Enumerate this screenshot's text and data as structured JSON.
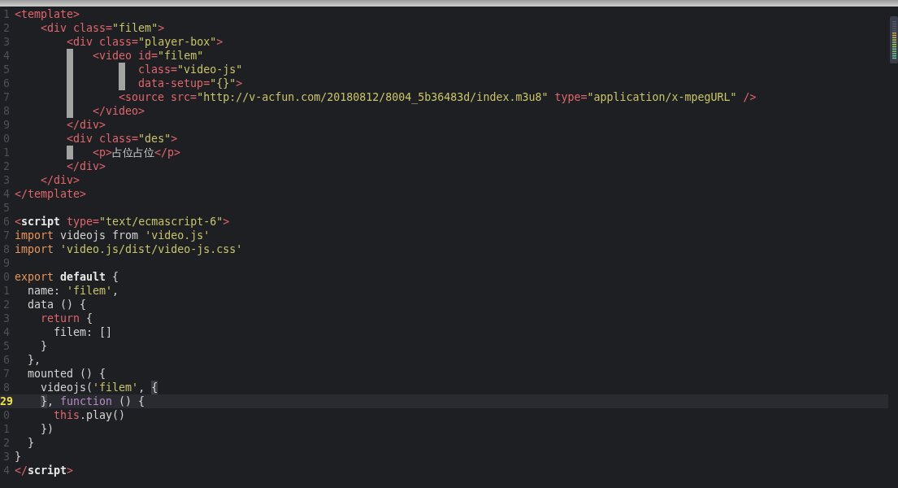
{
  "editor": {
    "lines": [
      {
        "number": "1",
        "current": false,
        "tokens": [
          {
            "kind": "tag",
            "text": "<template>"
          }
        ]
      },
      {
        "number": "2",
        "current": false,
        "tokens": [
          {
            "kind": "tag",
            "text": "    <div class="
          },
          {
            "kind": "string",
            "text": "\"filem\""
          },
          {
            "kind": "tag",
            "text": ">"
          }
        ]
      },
      {
        "number": "3",
        "current": false,
        "tokens": [
          {
            "kind": "tag",
            "text": "        <div class="
          },
          {
            "kind": "string",
            "text": "\"player-box\""
          },
          {
            "kind": "tag",
            "text": ">"
          }
        ]
      },
      {
        "number": "4",
        "current": false,
        "tokens": [
          {
            "kind": "indent"
          },
          {
            "kind": "indent"
          },
          {
            "kind": "guide-tab"
          },
          {
            "kind": "tag",
            "text": "<video id="
          },
          {
            "kind": "string",
            "text": "\"filem\""
          }
        ]
      },
      {
        "number": "5",
        "current": false,
        "tokens": [
          {
            "kind": "indent"
          },
          {
            "kind": "indent"
          },
          {
            "kind": "guide-tab"
          },
          {
            "kind": "indent"
          },
          {
            "kind": "guide"
          },
          {
            "kind": "tag",
            "text": "  class="
          },
          {
            "kind": "string",
            "text": "\"video-js\""
          }
        ]
      },
      {
        "number": "6",
        "current": false,
        "tokens": [
          {
            "kind": "indent"
          },
          {
            "kind": "indent"
          },
          {
            "kind": "guide-tab"
          },
          {
            "kind": "indent"
          },
          {
            "kind": "guide"
          },
          {
            "kind": "tag",
            "text": "  data-setup="
          },
          {
            "kind": "string",
            "text": "\"{}\""
          },
          {
            "kind": "tag",
            "text": ">"
          }
        ]
      },
      {
        "number": "7",
        "current": false,
        "tokens": [
          {
            "kind": "indent"
          },
          {
            "kind": "indent"
          },
          {
            "kind": "guide-tab"
          },
          {
            "kind": "indent"
          },
          {
            "kind": "tag",
            "text": "<source src="
          },
          {
            "kind": "string",
            "text": "\"http://v-acfun.com/20180812/8004_5b36483d/index.m3u8\""
          },
          {
            "kind": "tag",
            "text": " type="
          },
          {
            "kind": "string",
            "text": "\"application/x-mpegURL\""
          },
          {
            "kind": "tag",
            "text": " />"
          }
        ]
      },
      {
        "number": "8",
        "current": false,
        "tokens": [
          {
            "kind": "indent"
          },
          {
            "kind": "indent"
          },
          {
            "kind": "guide-tab"
          },
          {
            "kind": "tag",
            "text": "</video>"
          }
        ]
      },
      {
        "number": "9",
        "current": false,
        "tokens": [
          {
            "kind": "tag",
            "text": "        </div>"
          }
        ]
      },
      {
        "number": "0",
        "current": false,
        "tokens": [
          {
            "kind": "tag",
            "text": "        <div class="
          },
          {
            "kind": "string",
            "text": "\"des\""
          },
          {
            "kind": "tag",
            "text": ">"
          }
        ]
      },
      {
        "number": "1",
        "current": false,
        "tokens": [
          {
            "kind": "indent"
          },
          {
            "kind": "indent"
          },
          {
            "kind": "guide-tab"
          },
          {
            "kind": "tag",
            "text": "<p>"
          },
          {
            "kind": "plain",
            "text": "占位占位"
          },
          {
            "kind": "tag",
            "text": "</p>"
          }
        ]
      },
      {
        "number": "2",
        "current": false,
        "tokens": [
          {
            "kind": "tag",
            "text": "        </div>"
          }
        ]
      },
      {
        "number": "3",
        "current": false,
        "tokens": [
          {
            "kind": "tag",
            "text": "    </div>"
          }
        ]
      },
      {
        "number": "4",
        "current": false,
        "tokens": [
          {
            "kind": "tag",
            "text": "</template>"
          }
        ]
      },
      {
        "number": "5",
        "current": false
      },
      {
        "number": "6",
        "current": false,
        "tokens": [
          {
            "kind": "tag",
            "text": "<"
          },
          {
            "kind": "bold",
            "text": "script"
          },
          {
            "kind": "tag",
            "text": " type="
          },
          {
            "kind": "string",
            "text": "\"text/ecmascript-6\""
          },
          {
            "kind": "tag",
            "text": ">"
          }
        ]
      },
      {
        "number": "7",
        "current": false,
        "tokens": [
          {
            "kind": "keyword",
            "text": "import"
          },
          {
            "kind": "plain",
            "text": " videojs from "
          },
          {
            "kind": "string",
            "text": "'video.js'"
          }
        ]
      },
      {
        "number": "8",
        "current": false,
        "tokens": [
          {
            "kind": "keyword",
            "text": "import"
          },
          {
            "kind": "string",
            "text": " 'video.js/dist/video-js.css'"
          }
        ]
      },
      {
        "number": "9",
        "current": false
      },
      {
        "number": "0",
        "current": false,
        "tokens": [
          {
            "kind": "keyword",
            "text": "export"
          },
          {
            "kind": "bold",
            "text": " default"
          },
          {
            "kind": "plain",
            "text": " {"
          }
        ]
      },
      {
        "number": "1",
        "current": false,
        "tokens": [
          {
            "kind": "plain",
            "text": "  name: "
          },
          {
            "kind": "string",
            "text": "'filem'"
          },
          {
            "kind": "plain",
            "text": ","
          }
        ]
      },
      {
        "number": "2",
        "current": false,
        "tokens": [
          {
            "kind": "plain",
            "text": "  data () {"
          }
        ]
      },
      {
        "number": "3",
        "current": false,
        "tokens": [
          {
            "kind": "control",
            "text": "    return"
          },
          {
            "kind": "plain",
            "text": " {"
          }
        ]
      },
      {
        "number": "4",
        "current": false,
        "tokens": [
          {
            "kind": "plain",
            "text": "      filem: []"
          }
        ]
      },
      {
        "number": "5",
        "current": false,
        "tokens": [
          {
            "kind": "plain",
            "text": "    }"
          }
        ]
      },
      {
        "number": "6",
        "current": false,
        "tokens": [
          {
            "kind": "plain",
            "text": "  },"
          }
        ]
      },
      {
        "number": "7",
        "current": false,
        "tokens": [
          {
            "kind": "plain",
            "text": "  mounted () {"
          }
        ]
      },
      {
        "number": "8",
        "current": false,
        "tokens": [
          {
            "kind": "plain",
            "text": "    videojs("
          },
          {
            "kind": "string",
            "text": "'filem'"
          },
          {
            "kind": "plain",
            "text": ", "
          },
          {
            "kind": "match",
            "text": "{"
          }
        ]
      },
      {
        "number": "29",
        "current": true,
        "tokens": [
          {
            "kind": "indent"
          },
          {
            "kind": "match",
            "text": "}"
          },
          {
            "kind": "plain",
            "text": ", "
          },
          {
            "kind": "function",
            "text": "function"
          },
          {
            "kind": "plain",
            "text": " () {"
          }
        ]
      },
      {
        "number": "0",
        "current": false,
        "tokens": [
          {
            "kind": "control",
            "text": "      this"
          },
          {
            "kind": "plain",
            "text": ".play()"
          }
        ]
      },
      {
        "number": "1",
        "current": false,
        "tokens": [
          {
            "kind": "plain",
            "text": "    })"
          }
        ]
      },
      {
        "number": "2",
        "current": false,
        "tokens": [
          {
            "kind": "plain",
            "text": "  }"
          }
        ]
      },
      {
        "number": "3",
        "current": false,
        "tokens": [
          {
            "kind": "plain",
            "text": "}"
          }
        ]
      },
      {
        "number": "4",
        "current": false,
        "tokens": [
          {
            "kind": "tag",
            "text": "</"
          },
          {
            "kind": "bold",
            "text": "script"
          },
          {
            "kind": "tag",
            "text": ">"
          }
        ]
      }
    ]
  }
}
